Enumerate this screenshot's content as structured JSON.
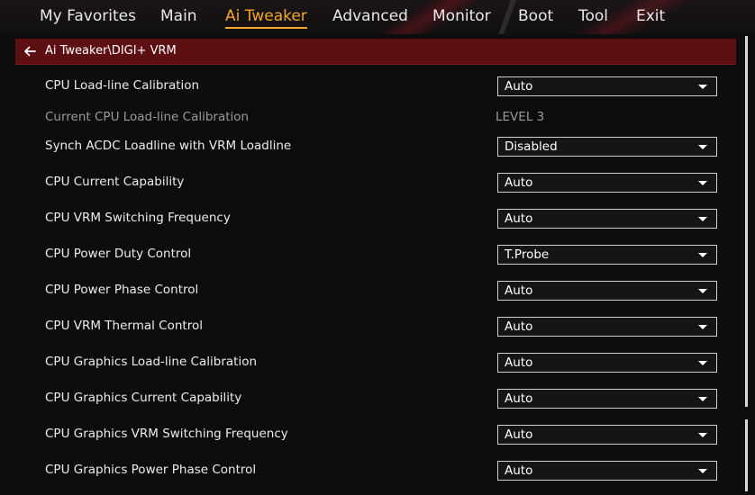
{
  "nav": {
    "items": [
      {
        "label": "My Favorites",
        "active": false
      },
      {
        "label": "Main",
        "active": false
      },
      {
        "label": "Ai Tweaker",
        "active": true
      },
      {
        "label": "Advanced",
        "active": false
      },
      {
        "label": "Monitor",
        "active": false
      },
      {
        "label": "Boot",
        "active": false
      },
      {
        "label": "Tool",
        "active": false
      },
      {
        "label": "Exit",
        "active": false
      }
    ]
  },
  "breadcrumb": {
    "path": "Ai Tweaker\\DIGI+ VRM",
    "back_icon": "arrow-left-icon"
  },
  "settings": [
    {
      "label": "CPU Load-line Calibration",
      "type": "dropdown",
      "value": "Auto"
    },
    {
      "label": "Current CPU Load-line Calibration",
      "type": "readonly",
      "value": "LEVEL 3"
    },
    {
      "label": "Synch ACDC Loadline with VRM Loadline",
      "type": "dropdown",
      "value": "Disabled"
    },
    {
      "label": "CPU Current Capability",
      "type": "dropdown",
      "value": "Auto"
    },
    {
      "label": "CPU VRM Switching Frequency",
      "type": "dropdown",
      "value": "Auto"
    },
    {
      "label": "CPU Power Duty Control",
      "type": "dropdown",
      "value": "T.Probe"
    },
    {
      "label": "CPU Power Phase Control",
      "type": "dropdown",
      "value": "Auto"
    },
    {
      "label": "CPU VRM Thermal Control",
      "type": "dropdown",
      "value": "Auto"
    },
    {
      "label": "CPU Graphics Load-line Calibration",
      "type": "dropdown",
      "value": "Auto"
    },
    {
      "label": "CPU Graphics Current Capability",
      "type": "dropdown",
      "value": "Auto"
    },
    {
      "label": "CPU Graphics VRM Switching Frequency",
      "type": "dropdown",
      "value": "Auto"
    },
    {
      "label": "CPU Graphics Power Phase Control",
      "type": "dropdown",
      "value": "Auto"
    }
  ],
  "colors": {
    "accent": "#f5a623",
    "breadcrumb_bg": "#5e0f12",
    "background": "#0d0d0d"
  }
}
